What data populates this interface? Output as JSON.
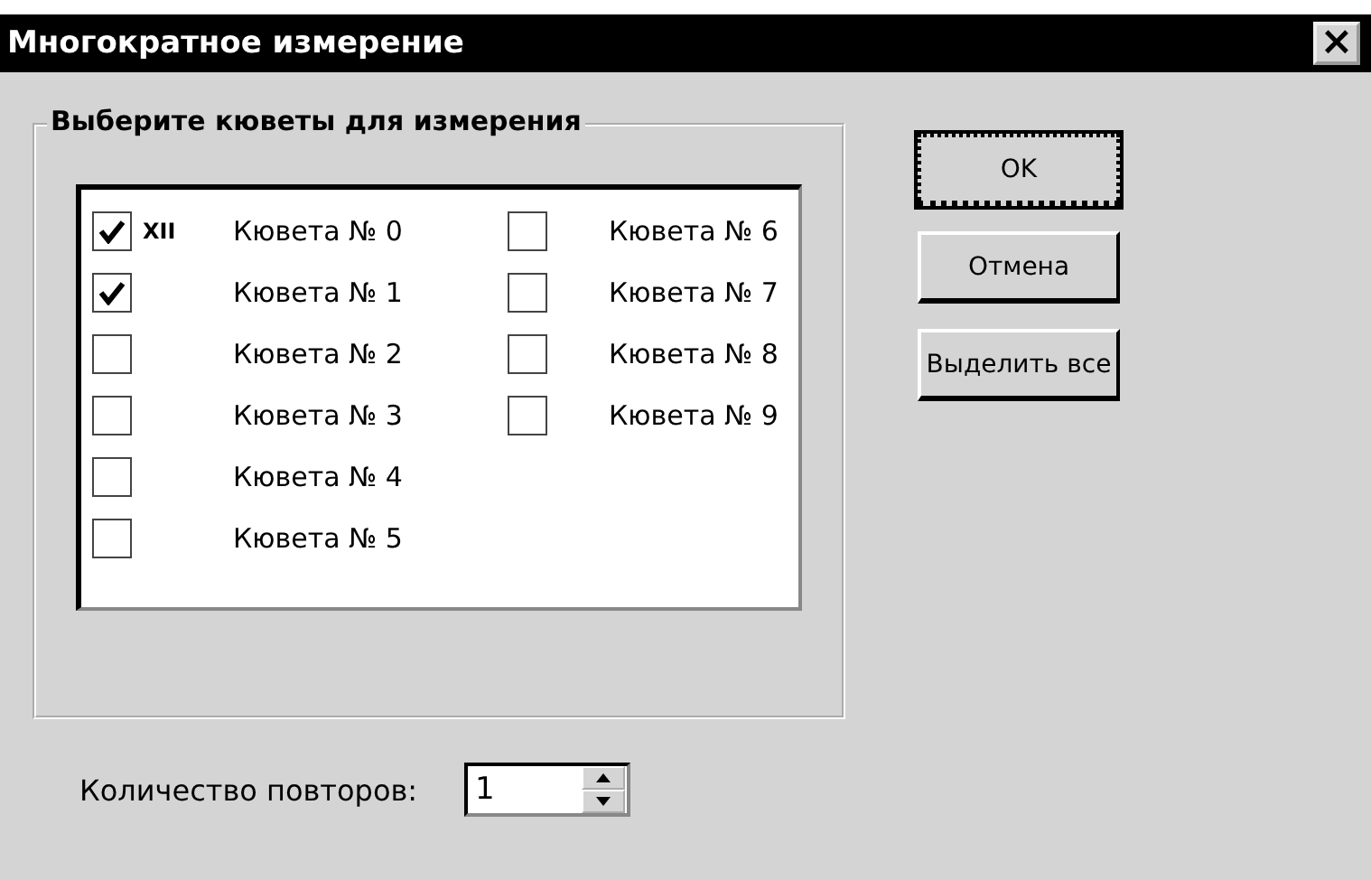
{
  "window": {
    "title": "Многократное измерение",
    "close": "×"
  },
  "group": {
    "title": "Выберите кюветы для измерения",
    "items": [
      {
        "label": "Кювета № 0",
        "checked": true,
        "prefix": "XII"
      },
      {
        "label": "Кювета № 1",
        "checked": true
      },
      {
        "label": "Кювета № 2",
        "checked": false
      },
      {
        "label": "Кювета № 3",
        "checked": false
      },
      {
        "label": "Кювета № 4",
        "checked": false
      },
      {
        "label": "Кювета № 5",
        "checked": false
      },
      {
        "label": "Кювета № 6",
        "checked": false
      },
      {
        "label": "Кювета № 7",
        "checked": false
      },
      {
        "label": "Кювета № 8",
        "checked": false
      },
      {
        "label": "Кювета № 9",
        "checked": false
      }
    ]
  },
  "buttons": [
    {
      "label": "OK",
      "default": true
    },
    {
      "label": "Отмена",
      "default": false
    },
    {
      "label": "Выделить все",
      "default": false
    }
  ],
  "repeats": {
    "label": "Количество повторов:",
    "value": "1"
  }
}
